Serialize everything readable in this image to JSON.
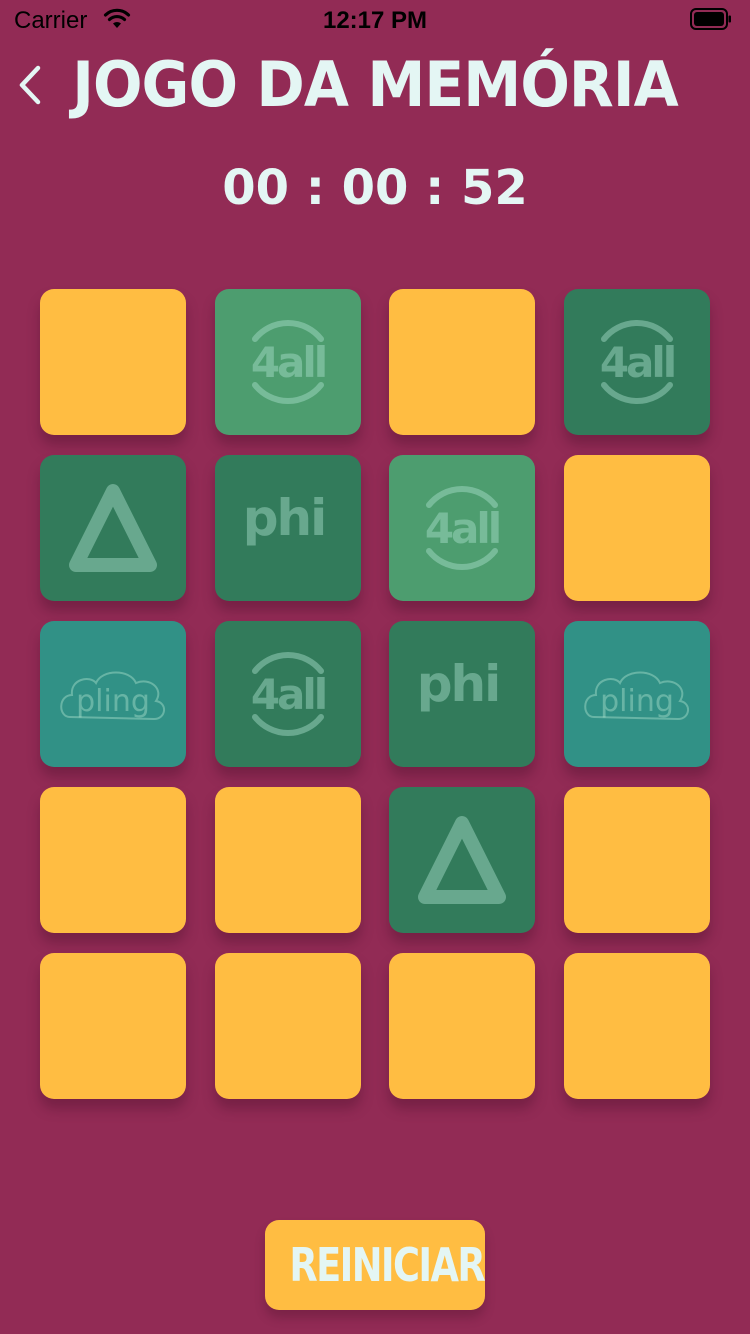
{
  "status_bar": {
    "carrier": "Carrier",
    "time": "12:17 PM"
  },
  "header": {
    "title": "JOGO DA MEMÓRIA",
    "timer": "00 : 00 : 52"
  },
  "colors": {
    "background": "#922B55",
    "card_back": "#FFBD42",
    "card_dark_green": "#327B5B",
    "card_light_green": "#4D9D6F",
    "card_teal": "#319186",
    "text_light": "#E4F6F4"
  },
  "board": {
    "columns": 4,
    "rows": 5,
    "cards": [
      {
        "state": "hidden",
        "logo": ""
      },
      {
        "state": "matched",
        "logo": "4all"
      },
      {
        "state": "hidden",
        "logo": ""
      },
      {
        "state": "revealed",
        "logo": "4all"
      },
      {
        "state": "revealed",
        "logo": "triangle"
      },
      {
        "state": "revealed",
        "logo": "phi"
      },
      {
        "state": "matched",
        "logo": "4all"
      },
      {
        "state": "hidden",
        "logo": ""
      },
      {
        "state": "revealed-teal",
        "logo": "pling"
      },
      {
        "state": "revealed",
        "logo": "4all"
      },
      {
        "state": "revealed",
        "logo": "phi"
      },
      {
        "state": "revealed-teal",
        "logo": "pling"
      },
      {
        "state": "hidden",
        "logo": ""
      },
      {
        "state": "hidden",
        "logo": ""
      },
      {
        "state": "revealed",
        "logo": "triangle"
      },
      {
        "state": "hidden",
        "logo": ""
      },
      {
        "state": "hidden",
        "logo": ""
      },
      {
        "state": "hidden",
        "logo": ""
      },
      {
        "state": "hidden",
        "logo": ""
      },
      {
        "state": "hidden",
        "logo": ""
      }
    ]
  },
  "footer": {
    "restart_label": "REINICIAR"
  }
}
